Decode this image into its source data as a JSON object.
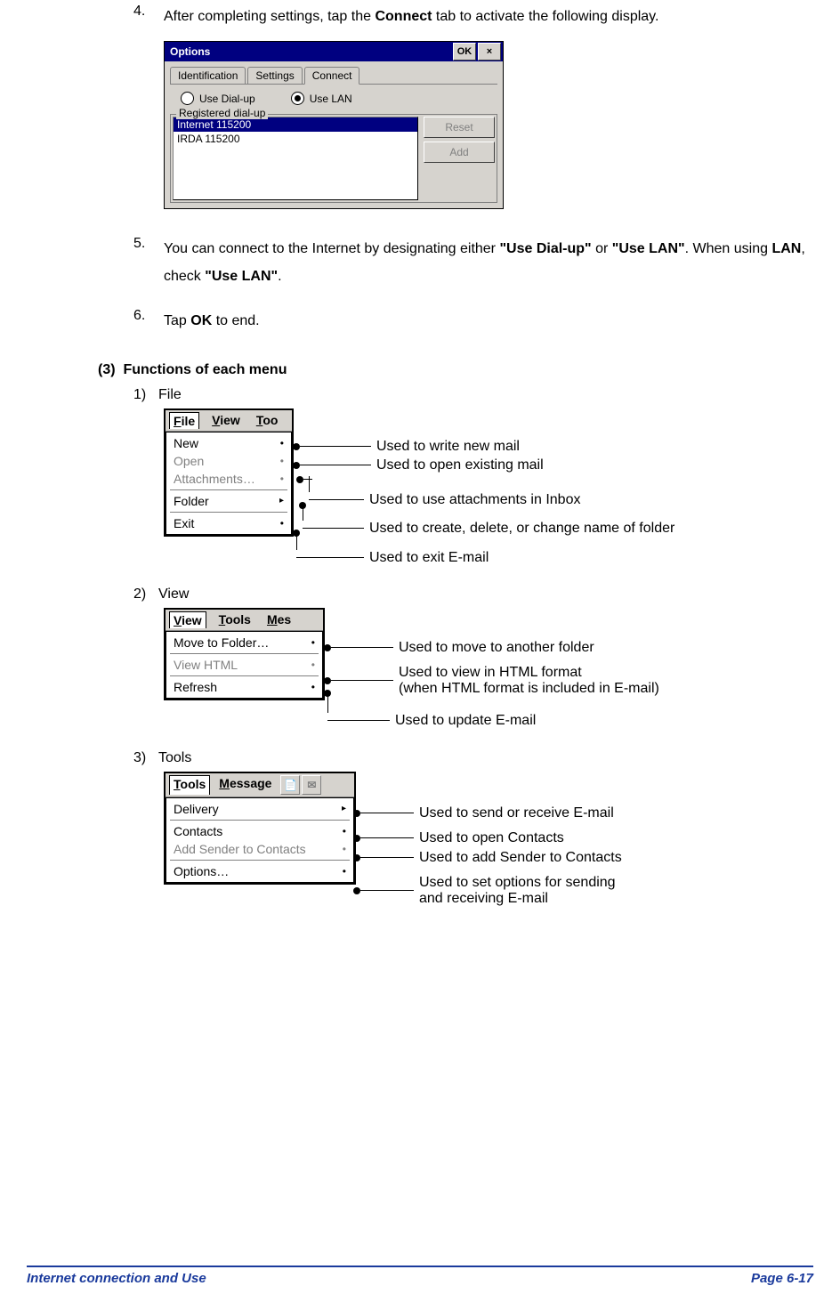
{
  "step4": {
    "num": "4.",
    "text_a": "After completing settings, tap the ",
    "text_b": "Connect",
    "text_c": " tab to activate the following display."
  },
  "dialog": {
    "title": "Options",
    "ok": "OK",
    "close": "×",
    "tabs": [
      "Identification",
      "Settings",
      "Connect"
    ],
    "radio_dialup": "Use Dial-up",
    "radio_lan": "Use LAN",
    "legend": "Registered dial-up",
    "list": [
      "Internet 115200",
      "IRDA 115200"
    ],
    "btn_reset": "Reset",
    "btn_add": "Add"
  },
  "step5": {
    "num": "5.",
    "a": "You can connect to the Internet by designating either ",
    "b": "\"Use Dial-up\"",
    "c": " or ",
    "d": "\"Use LAN\"",
    "e": ". When using ",
    "f": "LAN",
    "g": ", check ",
    "h": "\"Use LAN\"",
    "i": "."
  },
  "step6": {
    "num": "6.",
    "a": "Tap ",
    "b": "OK",
    "c": " to end."
  },
  "section": {
    "num": "(3)",
    "title": "Functions of each menu"
  },
  "file": {
    "idx": "1)",
    "name": "File",
    "menubar": [
      "File",
      "View",
      "Too"
    ],
    "items": [
      "New",
      "Open",
      "Attachments…",
      "Folder",
      "Exit"
    ],
    "ann": [
      "Used to write new mail",
      "Used to open existing mail",
      "Used to use attachments in Inbox",
      "Used to create, delete, or change name of folder",
      "Used to exit E-mail"
    ]
  },
  "view": {
    "idx": "2)",
    "name": "View",
    "menubar": [
      "View",
      "Tools",
      "Mes"
    ],
    "items": [
      "Move to Folder…",
      "View HTML",
      "Refresh"
    ],
    "ann": [
      "Used to move to another folder",
      "Used to view in HTML format",
      "(when HTML format is included in E-mail)",
      "Used to update E-mail"
    ]
  },
  "tools": {
    "idx": "3)",
    "name": "Tools",
    "menubar": [
      "Tools",
      "Message"
    ],
    "items": [
      "Delivery",
      "Contacts",
      "Add Sender to Contacts",
      "Options…"
    ],
    "ann": [
      "Used to send or receive E-mail",
      "Used to open Contacts",
      "Used to add Sender to Contacts",
      "Used to set options for sending",
      "and receiving E-mail"
    ]
  },
  "footer": {
    "left": "Internet connection and Use",
    "right": "Page 6-17"
  }
}
